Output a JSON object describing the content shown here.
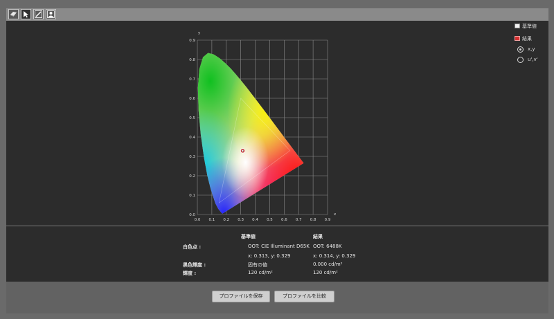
{
  "toolbar": {
    "tools": [
      {
        "name": "display-tool",
        "icon": "display-icon"
      },
      {
        "name": "pointer-tool",
        "icon": "pointer-icon"
      },
      {
        "name": "edit-tool",
        "icon": "pencil-icon"
      },
      {
        "name": "profile-tool",
        "icon": "person-icon"
      }
    ]
  },
  "legend": {
    "standard_label": "基準値",
    "result_label": "結果",
    "standard_color": "#f2f2f2",
    "result_color": "#d43030"
  },
  "space_options": {
    "xy_label": "x,y",
    "uv_label": "u',v'",
    "selected": "xy"
  },
  "chart_data": {
    "type": "scatter",
    "xlabel": "x",
    "ylabel": "y",
    "xlim": [
      0,
      0.9
    ],
    "ylim": [
      0,
      0.9
    ],
    "xticks": [
      "0.0",
      "0.1",
      "0.2",
      "0.3",
      "0.4",
      "0.5",
      "0.6",
      "0.7",
      "0.8",
      "0.9"
    ],
    "yticks": [
      "0.0",
      "0.1",
      "0.2",
      "0.3",
      "0.4",
      "0.5",
      "0.6",
      "0.7",
      "0.8",
      "0.9"
    ],
    "grid": true,
    "gamut_triangle": [
      [
        0.64,
        0.33
      ],
      [
        0.3,
        0.6
      ],
      [
        0.15,
        0.06
      ]
    ],
    "white_point_standard": [
      0.3127,
      0.329
    ],
    "white_point_result": [
      0.3135,
      0.329
    ]
  },
  "info": {
    "col_standard": "基準値",
    "col_result": "結果",
    "rows": [
      {
        "label": "白色点 :",
        "standard": "OOT: CIE Illuminant D65K",
        "result": "OOT: 6488K"
      },
      {
        "label": "",
        "standard": "x: 0.313, y: 0.329",
        "result": "x: 0.314, y: 0.329"
      },
      {
        "label": "黒色輝度 :",
        "standard": "固有の値",
        "result": "0.000 cd/m²"
      },
      {
        "label": "輝度 :",
        "standard": "120 cd/m²",
        "result": "120 cd/m²"
      }
    ]
  },
  "buttons": {
    "save_profile": "プロファイルを保存",
    "compare_profile": "プロファイルを比較"
  }
}
